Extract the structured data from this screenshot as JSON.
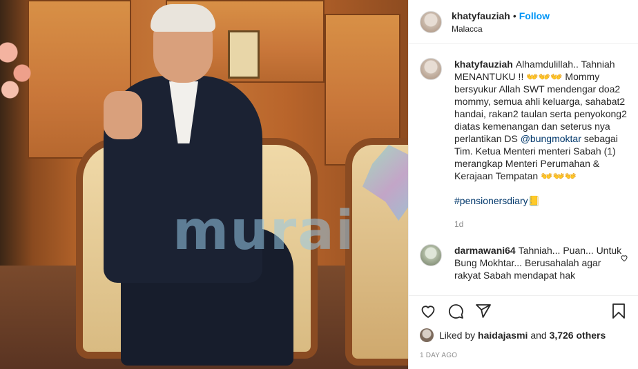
{
  "post": {
    "username": "khatyfauziah",
    "separator": "•",
    "follow_label": "Follow",
    "location": "Malacca"
  },
  "photo": {
    "watermark_text": "murai"
  },
  "caption": {
    "username": "khatyfauziah",
    "text_1": "Alhamdulillah.. Tahniah MENANTUKU !! ",
    "emoji_1": "👐👐👐",
    "text_2": " Mommy bersyukur Allah SWT mendengar doa2 mommy, semua ahli keluarga, sahabat2 handai, rakan2 taulan serta penyokong2 diatas kemenangan dan seterus nya perlantikan DS ",
    "mention": "@bungmoktar",
    "text_3": " sebagai Tim. Ketua Menteri menteri Sabah (1) merangkap Menteri Perumahan & Kerajaan Tempatan ",
    "emoji_2": "👐👐👐",
    "hashtag": "#pensionersdiary",
    "hashtag_emoji": "📒",
    "time": "1d"
  },
  "reply": {
    "username": "darmawani64",
    "text": "Tahniah... Puan... Untuk Bung Mokhtar... Berusahalah agar rakyat Sabah mendapat hak"
  },
  "likes": {
    "prefix": "Liked by ",
    "user": "haidajasmi",
    "middle": " and ",
    "count": "3,726 others"
  },
  "posted_ago": "1 DAY AGO",
  "icons": [
    "heart-icon",
    "comment-icon",
    "share-icon",
    "bookmark-icon"
  ]
}
